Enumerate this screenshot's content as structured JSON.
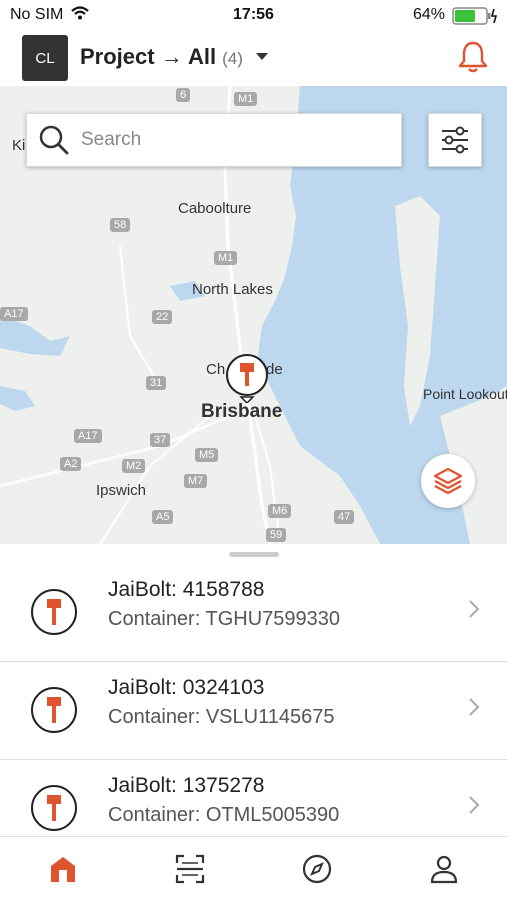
{
  "status_bar": {
    "carrier": "No SIM",
    "time": "17:56",
    "battery": "64%"
  },
  "header": {
    "avatar": "CL",
    "project_label": "Project",
    "arrow": "→",
    "filter_label": "All",
    "count": "(4)"
  },
  "search": {
    "placeholder": "Search"
  },
  "map": {
    "place_labels": [
      "Caboolture",
      "North Lakes",
      "Brisbane",
      "Ipswich",
      "Point Lookout",
      "Ki",
      "Ch",
      "de"
    ],
    "shields": [
      "6",
      "M1",
      "58",
      "M1",
      "22",
      "A17",
      "31",
      "37",
      "A17",
      "A2",
      "M2",
      "M5",
      "M7",
      "M6",
      "47",
      "A5",
      "59"
    ]
  },
  "devices": [
    {
      "bolt_label": "JaiBolt:",
      "bolt_id": "4158788",
      "container_label": "Container:",
      "container_id": "TGHU7599330"
    },
    {
      "bolt_label": "JaiBolt:",
      "bolt_id": "0324103",
      "container_label": "Container:",
      "container_id": "VSLU1145675"
    },
    {
      "bolt_label": "JaiBolt:",
      "bolt_id": "1375278",
      "container_label": "Container:",
      "container_id": "OTML5005390"
    }
  ],
  "tabs": [
    {
      "name": "home-icon"
    },
    {
      "name": "scan-icon"
    },
    {
      "name": "compass-icon"
    },
    {
      "name": "profile-icon"
    }
  ],
  "colors": {
    "accent": "#e0532f",
    "water": "#bcd7ee",
    "land": "#eef0ee"
  }
}
